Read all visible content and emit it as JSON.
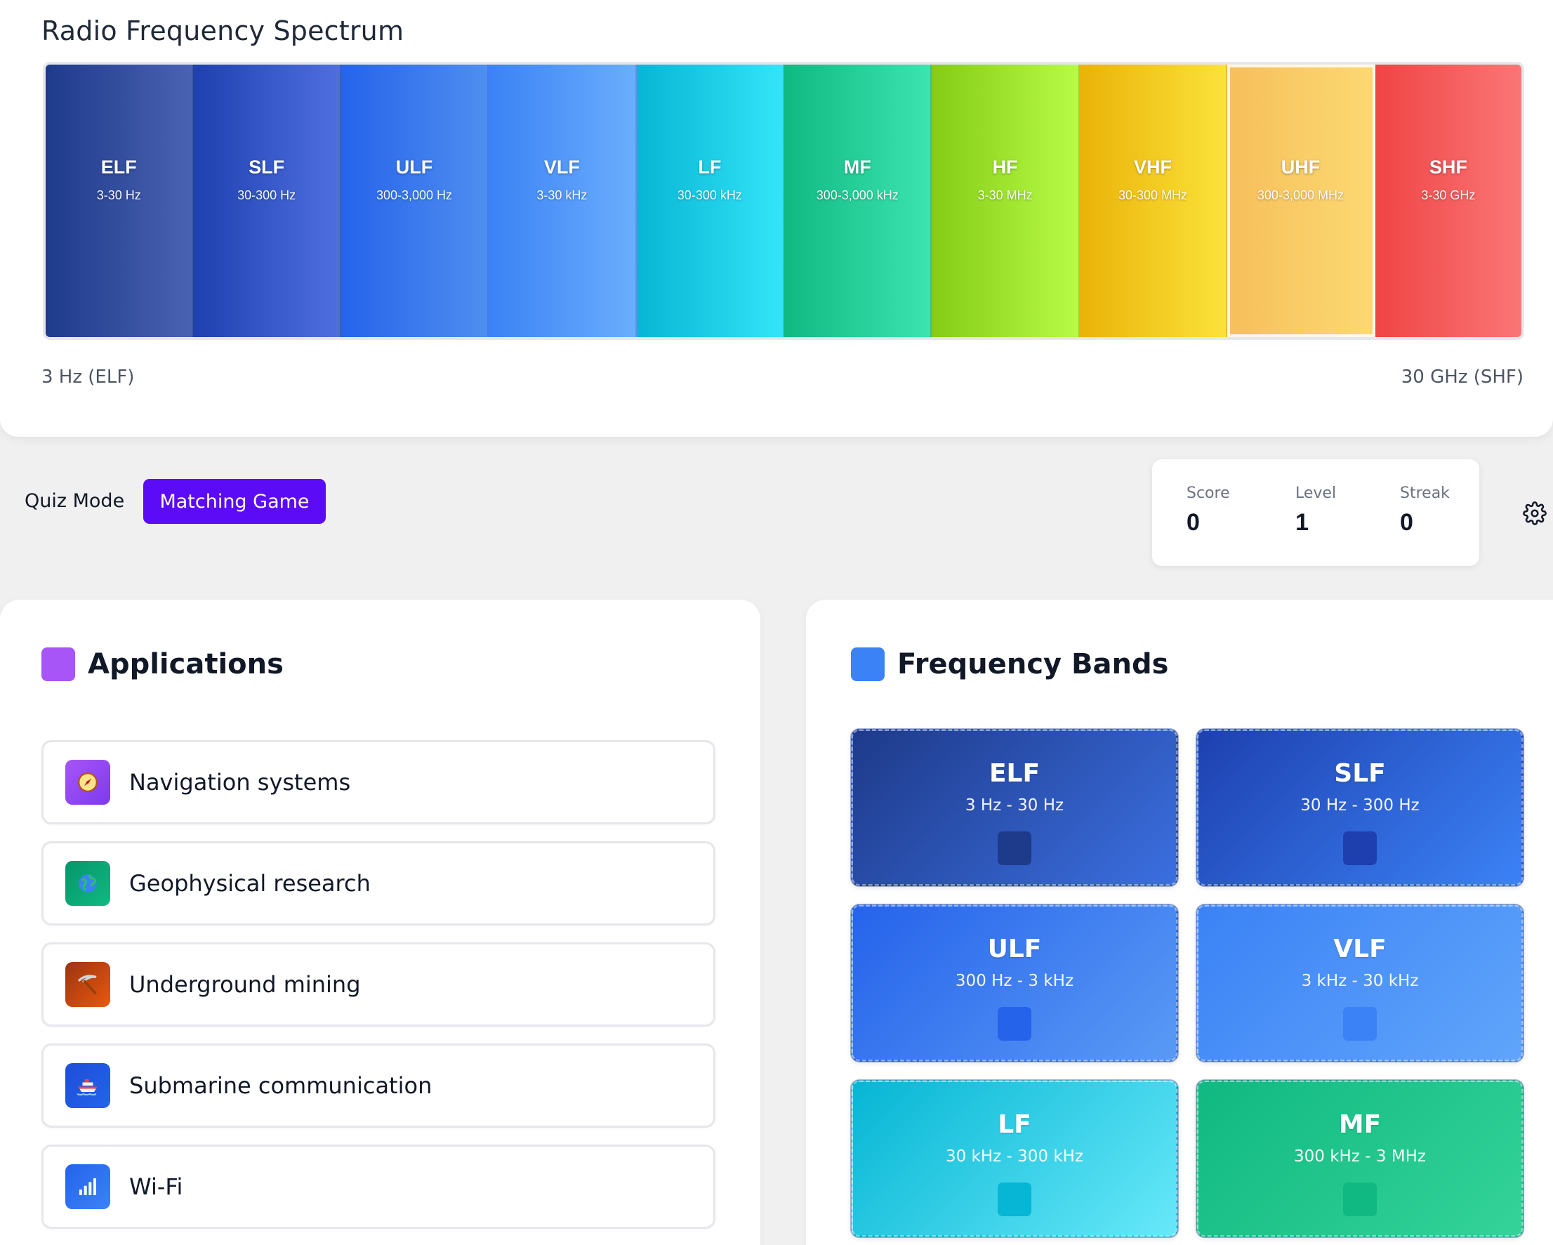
{
  "spectrum": {
    "title": "Radio Frequency Spectrum",
    "bands": [
      {
        "name": "ELF",
        "range": "3-30 Hz",
        "colors": [
          "#1e3a8a",
          "#4a62b2"
        ]
      },
      {
        "name": "SLF",
        "range": "30-300 Hz",
        "colors": [
          "#1e40af",
          "#4f6fe0"
        ]
      },
      {
        "name": "ULF",
        "range": "300-3,000 Hz",
        "colors": [
          "#2563eb",
          "#4f8ef0"
        ]
      },
      {
        "name": "VLF",
        "range": "3-30 kHz",
        "colors": [
          "#3b82f6",
          "#6aaefc"
        ]
      },
      {
        "name": "LF",
        "range": "30-300 kHz",
        "colors": [
          "#06b6d4",
          "#34e4f8"
        ]
      },
      {
        "name": "MF",
        "range": "300-3,000 kHz",
        "colors": [
          "#10b981",
          "#3ce5b0"
        ]
      },
      {
        "name": "HF",
        "range": "3-30 MHz",
        "colors": [
          "#84cc16",
          "#b8fb46"
        ]
      },
      {
        "name": "VHF",
        "range": "30-300 MHz",
        "colors": [
          "#eab308",
          "#fbe23a"
        ]
      },
      {
        "name": "UHF",
        "range": "300-3,000 MHz",
        "colors": [
          "#f6bf5a",
          "#fcd973"
        ]
      },
      {
        "name": "SHF",
        "range": "3-30 GHz",
        "colors": [
          "#ef4444",
          "#fb7676"
        ]
      }
    ],
    "selected_band": "UHF",
    "low_label": "3 Hz (ELF)",
    "high_label": "30 GHz (SHF)"
  },
  "controls": {
    "quiz_mode_label": "Quiz Mode",
    "mode_button_label": "Matching Game",
    "settings_icon": "gear-icon"
  },
  "stats": {
    "score_label": "Score",
    "score": "0",
    "level_label": "Level",
    "level": "1",
    "streak_label": "Streak",
    "streak": "0"
  },
  "applications": {
    "title": "Applications",
    "swatch_color": "#a855f7",
    "items": [
      {
        "label": "Navigation systems",
        "icon": "compass-icon",
        "colors": [
          "#a855f7",
          "#7c3aed"
        ]
      },
      {
        "label": "Geophysical research",
        "icon": "globe-icon",
        "colors": [
          "#059669",
          "#10b981"
        ]
      },
      {
        "label": "Underground mining",
        "icon": "pickaxe-icon",
        "colors": [
          "#9a3412",
          "#ea580c"
        ]
      },
      {
        "label": "Submarine communication",
        "icon": "ship-icon",
        "colors": [
          "#1d4ed8",
          "#2563eb"
        ]
      },
      {
        "label": "Wi-Fi",
        "icon": "signal-bars-icon",
        "colors": [
          "#2563eb",
          "#3b82f6"
        ]
      }
    ]
  },
  "frequency_bands": {
    "title": "Frequency Bands",
    "swatch_color": "#3b82f6",
    "cards": [
      {
        "name": "ELF",
        "range": "3 Hz - 30 Hz",
        "colors": [
          "#1e3a8a",
          "#3b6fe0"
        ],
        "slot": "#1e3a8a"
      },
      {
        "name": "SLF",
        "range": "30 Hz - 300 Hz",
        "colors": [
          "#1e40af",
          "#3b82f6"
        ],
        "slot": "#1e40af"
      },
      {
        "name": "ULF",
        "range": "300 Hz - 3 kHz",
        "colors": [
          "#2563eb",
          "#5a9af5"
        ],
        "slot": "#2563eb"
      },
      {
        "name": "VLF",
        "range": "3 kHz - 30 kHz",
        "colors": [
          "#3b82f6",
          "#60a5fa"
        ],
        "slot": "#3b82f6"
      },
      {
        "name": "LF",
        "range": "30 kHz - 300 kHz",
        "colors": [
          "#06b6d4",
          "#67e8f9"
        ],
        "slot": "#06b6d4"
      },
      {
        "name": "MF",
        "range": "300 kHz - 3 MHz",
        "colors": [
          "#10b981",
          "#34d399"
        ],
        "slot": "#10b981"
      }
    ]
  }
}
